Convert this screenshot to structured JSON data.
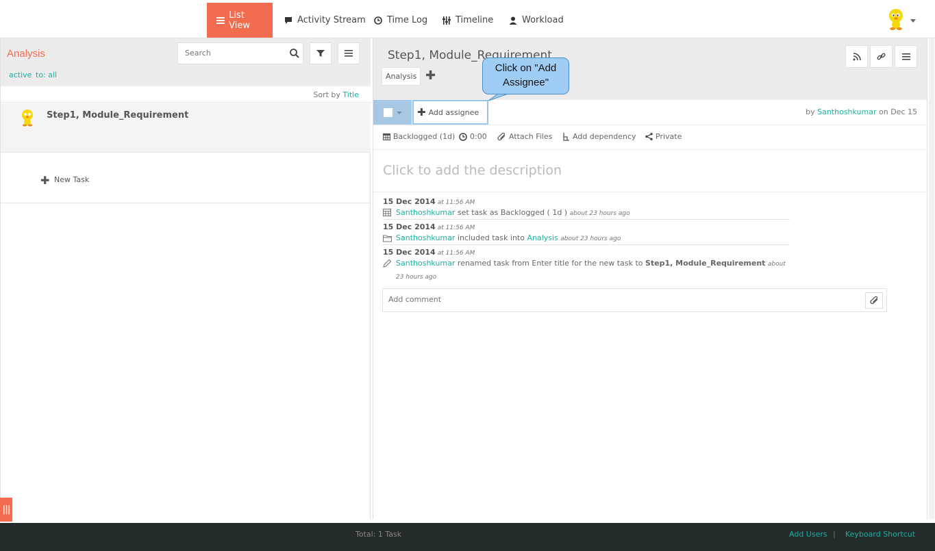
{
  "nav": {
    "items": [
      {
        "label": "List View",
        "icon": "list-icon"
      },
      {
        "label": "Activity Stream",
        "icon": "comment-icon"
      },
      {
        "label": "Time Log",
        "icon": "clock-icon"
      },
      {
        "label": "Timeline",
        "icon": "timeline-icon"
      },
      {
        "label": "Workload",
        "icon": "user-icon"
      }
    ],
    "active": "List View"
  },
  "colors": {
    "accent": "#f26c4f",
    "link": "#1bb0a3",
    "footer": "#232b2b",
    "callout": "#9fcdf3"
  },
  "left": {
    "title": "Analysis",
    "filters": [
      "active",
      "to: all"
    ],
    "search_placeholder": "Search",
    "sort_prefix": "Sort by",
    "sort_field": "Title",
    "tasks": [
      {
        "title": "Step1, Module_Requirement"
      }
    ],
    "new_task": "New Task"
  },
  "detail": {
    "title": "Step1, Module_Requirement",
    "project_tag": "Analysis",
    "add_assignee": "Add assignee",
    "by_prefix": "by",
    "author": "Santhoshkumar",
    "date_suffix": "on Dec 15",
    "meta": {
      "status": "Backlogged (1d)",
      "time": "0:00",
      "attach": "Attach Files",
      "dependency": "Add dependency",
      "privacy": "Private"
    },
    "description_placeholder": "Click to add the description",
    "activities": [
      {
        "date": "15 Dec 2014",
        "time": "at 11:56 AM",
        "user": "Santhoshkumar",
        "text": "set task as Backlogged ( 1d )",
        "ago": "about 23 hours ago"
      },
      {
        "date": "15 Dec 2014",
        "time": "at 11:56 AM",
        "user": "Santhoshkumar",
        "text": "included task into",
        "link": "Analysis",
        "ago": "about 23 hours ago"
      },
      {
        "date": "15 Dec 2014",
        "time": "at 11:56 AM",
        "user": "Santhoshkumar",
        "text": "renamed task from Enter title for the new task to",
        "bold": "Step1, Module_Requirement",
        "ago": "about 23 hours ago"
      }
    ],
    "comment_placeholder": "Add comment"
  },
  "callout": {
    "line1": "Click on \"Add",
    "line2": "Assignee\""
  },
  "footer": {
    "total": "Total: 1 Task",
    "add_users": "Add Users",
    "separator": "|",
    "shortcut": "Keyboard Shortcut"
  }
}
